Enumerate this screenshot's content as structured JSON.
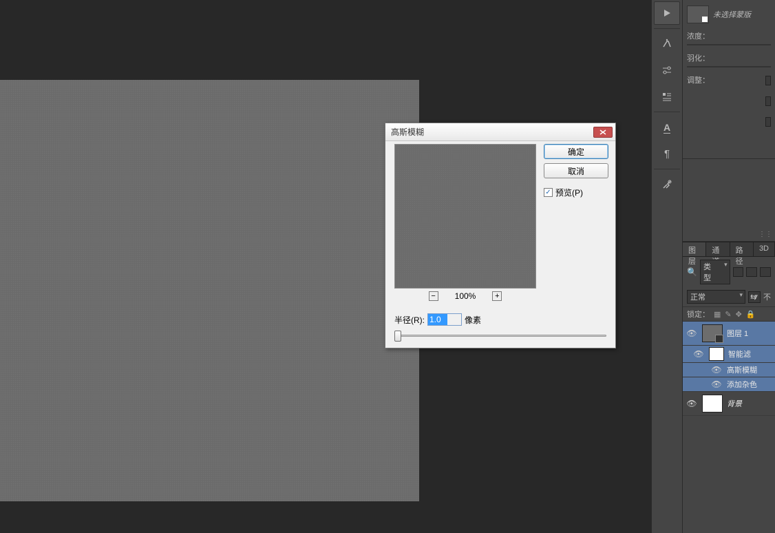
{
  "dialog": {
    "title": "高斯模糊",
    "ok_label": "确定",
    "cancel_label": "取消",
    "preview_label": "预览(P)",
    "zoom_value": "100%",
    "radius_label": "半径(R):",
    "radius_value": "1.0",
    "radius_unit": "像素"
  },
  "masks_panel": {
    "no_mask_label": "未选择蒙版",
    "density_label": "浓度：",
    "feather_label": "羽化：",
    "adjustments_label": "调整："
  },
  "layers_panel": {
    "tabs": [
      "图层",
      "通道",
      "路径",
      "3D"
    ],
    "kind_label": "类型",
    "blend_mode": "正常",
    "opacity_label": "不",
    "lock_label": "锁定：",
    "layers": [
      {
        "name": "图层 1",
        "smart_filters_label": "智能滤",
        "filters": [
          "高斯模糊",
          "添加杂色"
        ]
      },
      {
        "name": "背景"
      }
    ]
  },
  "toolbar_icons": [
    "play",
    "brush",
    "sliders",
    "ruler",
    "type",
    "paragraph",
    "wrench"
  ]
}
